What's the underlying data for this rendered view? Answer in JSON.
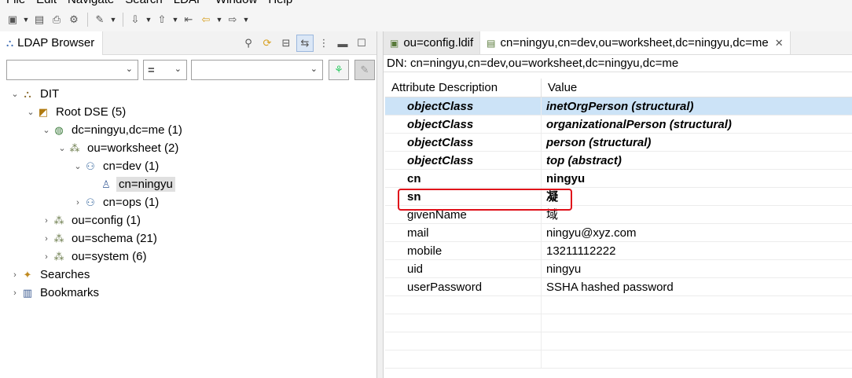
{
  "menu": [
    "File",
    "Edit",
    "Navigate",
    "Search",
    "LDAP",
    "Window",
    "Help"
  ],
  "browser": {
    "title": "LDAP Browser",
    "filter_operator": "=",
    "filter_attribute": "",
    "filter_value": ""
  },
  "tree": [
    {
      "label": "DIT",
      "level": 0,
      "twisty": "expanded",
      "icon": "dit-icon"
    },
    {
      "label": "Root DSE (5)",
      "level": 1,
      "twisty": "expanded",
      "icon": "root-dse-icon"
    },
    {
      "label": "dc=ningyu,dc=me (1)",
      "level": 2,
      "twisty": "expanded",
      "icon": "globe-icon"
    },
    {
      "label": "ou=worksheet (2)",
      "level": 3,
      "twisty": "expanded",
      "icon": "ou-icon"
    },
    {
      "label": "cn=dev (1)",
      "level": 4,
      "twisty": "expanded",
      "icon": "group-icon"
    },
    {
      "label": "cn=ningyu",
      "level": 5,
      "twisty": "none",
      "icon": "person-icon",
      "selected": true
    },
    {
      "label": "cn=ops (1)",
      "level": 4,
      "twisty": "collapsed",
      "icon": "group-icon"
    },
    {
      "label": "ou=config (1)",
      "level": 2,
      "twisty": "collapsed",
      "icon": "ou-icon"
    },
    {
      "label": "ou=schema (21)",
      "level": 2,
      "twisty": "collapsed",
      "icon": "ou-icon"
    },
    {
      "label": "ou=system (6)",
      "level": 2,
      "twisty": "collapsed",
      "icon": "ou-icon"
    },
    {
      "label": "Searches",
      "level": 0,
      "twisty": "collapsed",
      "icon": "searches-icon"
    },
    {
      "label": "Bookmarks",
      "level": 0,
      "twisty": "collapsed",
      "icon": "bookmarks-icon"
    }
  ],
  "editor": {
    "tabs": [
      {
        "label": "ou=config.ldif",
        "active": false
      },
      {
        "label": "cn=ningyu,cn=dev,ou=worksheet,dc=ningyu,dc=me",
        "active": true
      }
    ],
    "dn_line": "DN: cn=ningyu,cn=dev,ou=worksheet,dc=ningyu,dc=me",
    "columns": [
      "Attribute Description",
      "Value"
    ],
    "rows": [
      {
        "attr": "objectClass",
        "value": "inetOrgPerson (structural)",
        "kind": "oc",
        "selected": true
      },
      {
        "attr": "objectClass",
        "value": "organizationalPerson (structural)",
        "kind": "oc"
      },
      {
        "attr": "objectClass",
        "value": "person (structural)",
        "kind": "oc"
      },
      {
        "attr": "objectClass",
        "value": "top (abstract)",
        "kind": "oc"
      },
      {
        "attr": "cn",
        "value": "ningyu",
        "kind": "must"
      },
      {
        "attr": "sn",
        "value": "凝",
        "kind": "must"
      },
      {
        "attr": "givenName",
        "value": "域",
        "kind": "may",
        "highlighted": true
      },
      {
        "attr": "mail",
        "value": "ningyu@xyz.com",
        "kind": "may"
      },
      {
        "attr": "mobile",
        "value": "13211112222",
        "kind": "may"
      },
      {
        "attr": "uid",
        "value": "ningyu",
        "kind": "may"
      },
      {
        "attr": "userPassword",
        "value": "SSHA hashed password",
        "kind": "may"
      },
      {
        "attr": "",
        "value": "",
        "kind": "empty"
      },
      {
        "attr": "",
        "value": "",
        "kind": "empty"
      },
      {
        "attr": "",
        "value": "",
        "kind": "empty"
      },
      {
        "attr": "",
        "value": "",
        "kind": "empty"
      }
    ]
  },
  "colors": {
    "selection": "#cce3f7",
    "highlight_box": "#e0101a"
  }
}
